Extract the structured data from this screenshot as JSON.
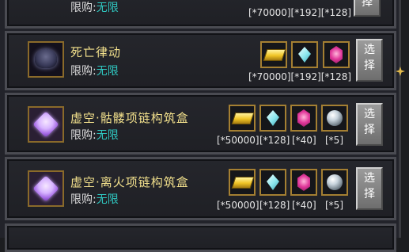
{
  "rows": [
    {
      "name": "",
      "limit_label": "限购:",
      "limit_value": "无限",
      "counts": "[*70000][*192][*128]",
      "button": "择"
    },
    {
      "name": "死亡律动",
      "limit_label": "限购:",
      "limit_value": "无限",
      "counts": "[*70000][*192][*128]",
      "button_top": "选",
      "button_bottom": "择"
    },
    {
      "name": "虚空·骷髅项链构筑盒",
      "limit_label": "限购:",
      "limit_value": "无限",
      "counts": [
        "[*50000]",
        "[*128]",
        "[*40]",
        "[*5]"
      ],
      "button_top": "选",
      "button_bottom": "择"
    },
    {
      "name": "虚空·离火项链构筑盒",
      "limit_label": "限购:",
      "limit_value": "无限",
      "counts": [
        "[*50000]",
        "[*128]",
        "[*40]",
        "[*5]"
      ],
      "button_top": "选",
      "button_bottom": "择"
    }
  ],
  "icons": {
    "gold": "gold-ingot-icon",
    "crystal": "crystal-icon",
    "gem": "pink-gem-icon",
    "orb": "silver-orb-icon"
  },
  "colors": {
    "name": "#f2e08c",
    "limit_value": "#2fc7c0",
    "icon_border": "#a47f32"
  }
}
